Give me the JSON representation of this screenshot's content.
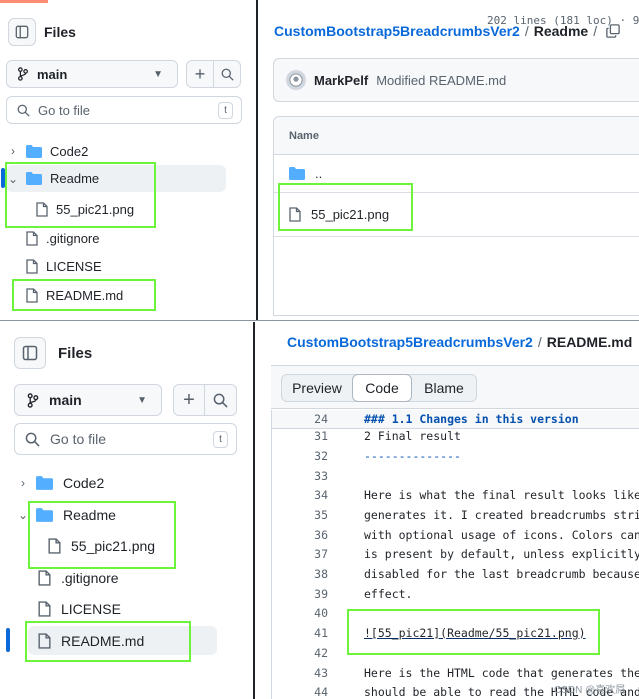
{
  "top": {
    "files_title": "Files",
    "branch": "main",
    "search_placeholder": "Go to file",
    "search_shortcut": "t",
    "tree": [
      {
        "label": "Code2",
        "type": "folder"
      },
      {
        "label": "Readme",
        "type": "folder"
      },
      {
        "label": "55_pic21.png",
        "type": "file"
      },
      {
        "label": ".gitignore",
        "type": "file"
      },
      {
        "label": "LICENSE",
        "type": "file"
      },
      {
        "label": "README.md",
        "type": "file"
      }
    ],
    "breadcrumb": {
      "repo": "CustomBootstrap5BreadcrumbsVer2",
      "sep": "/",
      "current": "Readme",
      "trail_sep": "/"
    },
    "commit": {
      "author": "MarkPelf",
      "message": "Modified README.md"
    },
    "table": {
      "header": "Name",
      "rows": [
        "..",
        "55_pic21.png"
      ]
    }
  },
  "bottom": {
    "files_title": "Files",
    "branch": "main",
    "search_placeholder": "Go to file",
    "search_shortcut": "t",
    "tree": [
      {
        "label": "Code2",
        "type": "folder"
      },
      {
        "label": "Readme",
        "type": "folder"
      },
      {
        "label": "55_pic21.png",
        "type": "file"
      },
      {
        "label": ".gitignore",
        "type": "file"
      },
      {
        "label": "LICENSE",
        "type": "file"
      },
      {
        "label": "README.md",
        "type": "file"
      }
    ],
    "breadcrumb": {
      "repo": "CustomBootstrap5BreadcrumbsVer2",
      "sep": "/",
      "current": "README.md"
    },
    "tabs": [
      "Preview",
      "Code",
      "Blame"
    ],
    "active_tab": "Code",
    "lines_info": "202 lines (181 loc) · 9",
    "code_lines": [
      {
        "n": "24",
        "text": "### 1.1 Changes in this version",
        "kind": "heading"
      },
      {
        "n": "31",
        "text": "2 Final result",
        "kind": "text"
      },
      {
        "n": "32",
        "text": "--------------",
        "kind": "rule"
      },
      {
        "n": "33",
        "text": "",
        "kind": "text"
      },
      {
        "n": "34",
        "text": "Here is what the final result looks like, t",
        "kind": "text"
      },
      {
        "n": "35",
        "text": "generates it. I created breadcrumbs strips",
        "kind": "text"
      },
      {
        "n": "36",
        "text": "with optional usage of icons. Colors can be",
        "kind": "text"
      },
      {
        "n": "37",
        "text": "is present by default, unless explicitly di",
        "kind": "text"
      },
      {
        "n": "38",
        "text": "disabled for the last breadcrumb because th",
        "kind": "text"
      },
      {
        "n": "39",
        "text": "effect.",
        "kind": "text"
      },
      {
        "n": "40",
        "text": "",
        "kind": "text"
      },
      {
        "n": "41",
        "text": "![55_pic21](Readme/55_pic21.png)",
        "kind": "link"
      },
      {
        "n": "42",
        "text": "",
        "kind": "text"
      },
      {
        "n": "43",
        "text": "Here is the HTML code that generates the ab",
        "kind": "text"
      },
      {
        "n": "44",
        "text": "should be able to read the HTML code and ma",
        "kind": "text"
      }
    ]
  },
  "watermark": "CSDN @喜欢屌",
  "colors": {
    "highlight": "#6ef33c",
    "link": "#0969da",
    "folder": "#54aeff"
  }
}
